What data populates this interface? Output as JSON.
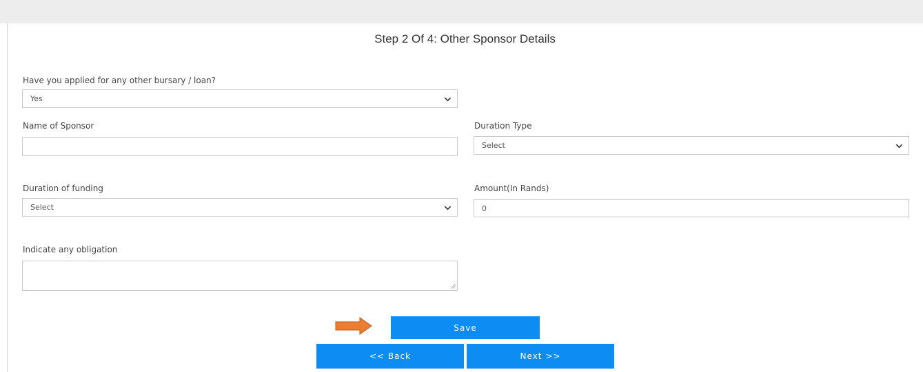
{
  "form": {
    "title": "Step 2 Of 4: Other Sponsor Details",
    "other_bursary": {
      "label": "Have you applied for any other bursary / loan?",
      "value": "Yes"
    },
    "sponsor_name": {
      "label": "Name of Sponsor",
      "value": ""
    },
    "duration_type": {
      "label": "Duration Type",
      "value": "Select"
    },
    "duration_funding": {
      "label": "Duration of funding",
      "value": "Select"
    },
    "amount": {
      "label": "Amount(In Rands)",
      "value": "0"
    },
    "obligation": {
      "label": "Indicate any obligation",
      "value": ""
    }
  },
  "buttons": {
    "save": "Save",
    "back": "<< Back",
    "next": "Next >>"
  },
  "colors": {
    "button": "#0d8cf3",
    "arrow": "#ed7d31"
  },
  "icons": {
    "select_chevron": "chevron-down-icon",
    "pointer_arrow": "arrow-right-icon"
  }
}
